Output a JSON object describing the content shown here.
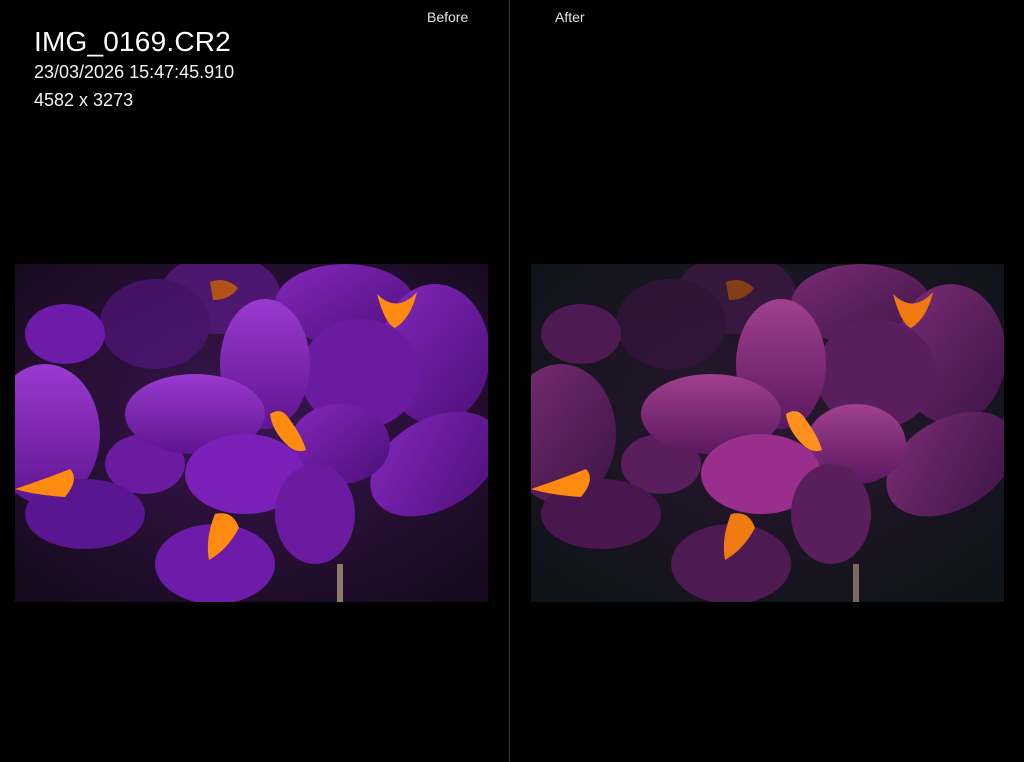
{
  "file": {
    "name": "IMG_0169.CR2",
    "datetime": "23/03/2026 15:47:45.910",
    "dimensions": "4582 x 3273"
  },
  "compare": {
    "before_label": "Before",
    "after_label": "After"
  },
  "colors": {
    "background": "#000000",
    "divider": "#3a3a3a",
    "before_petal": "#7a1fb0",
    "after_petal": "#8a2a7e",
    "stamen": "#ff8a10"
  }
}
